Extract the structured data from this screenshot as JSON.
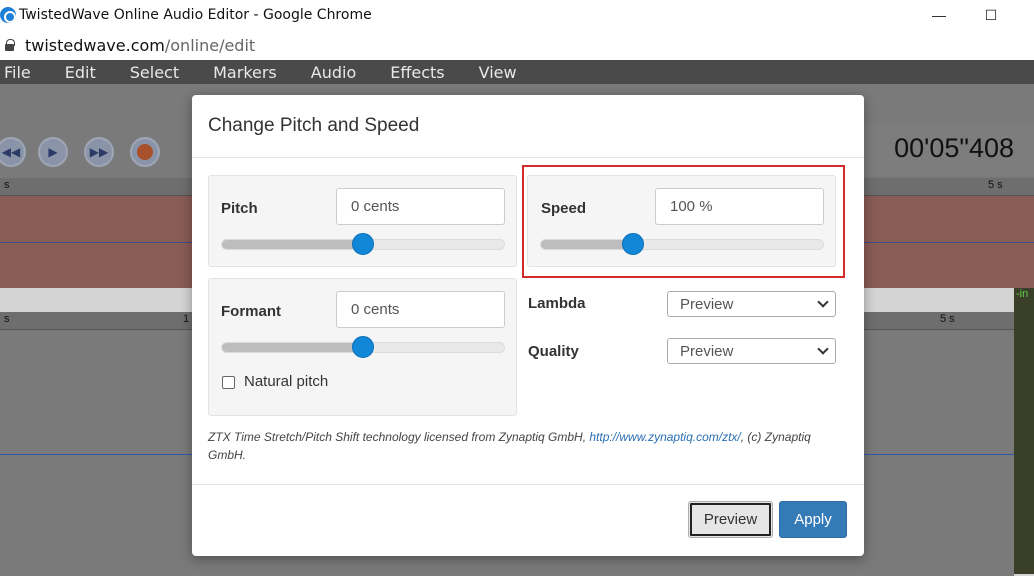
{
  "window": {
    "title": "TwistedWave Online Audio Editor - Google Chrome",
    "minimize_label": "—",
    "maximize_label": "☐"
  },
  "address": {
    "host": "twistedwave.com",
    "path": "/online/edit"
  },
  "menu": {
    "items": [
      "File",
      "Edit",
      "Select",
      "Markers",
      "Audio",
      "Effects",
      "View"
    ]
  },
  "transport": {
    "time": "00'05\"408",
    "buttons": [
      "rewind",
      "play",
      "fast-forward",
      "record"
    ]
  },
  "ruler": {
    "labels_top": [
      "s",
      "5 s"
    ],
    "labels_bottom": [
      "s",
      "1",
      "5 s"
    ]
  },
  "meter": {
    "label": "-in"
  },
  "dialog": {
    "title": "Change Pitch and Speed",
    "pitch": {
      "label": "Pitch",
      "value": "0 cents",
      "slider_fraction": 0.5
    },
    "formant": {
      "label": "Formant",
      "value": "0 cents",
      "slider_fraction": 0.5
    },
    "natural_pitch": {
      "label": "Natural pitch",
      "checked": false
    },
    "speed": {
      "label": "Speed",
      "value": "100 %",
      "slider_fraction": 0.33
    },
    "lambda": {
      "label": "Lambda",
      "value": "Preview"
    },
    "quality": {
      "label": "Quality",
      "value": "Preview"
    },
    "credit": {
      "text_before": "ZTX Time Stretch/Pitch Shift technology licensed from Zynaptiq GmbH, ",
      "link": "http://www.zynaptiq.com/ztx/",
      "text_after": ", (c) Zynaptiq GmbH."
    },
    "preview_button": "Preview",
    "apply_button": "Apply",
    "highlight_color": "#d32a2a",
    "accent_color": "#337ab7"
  }
}
